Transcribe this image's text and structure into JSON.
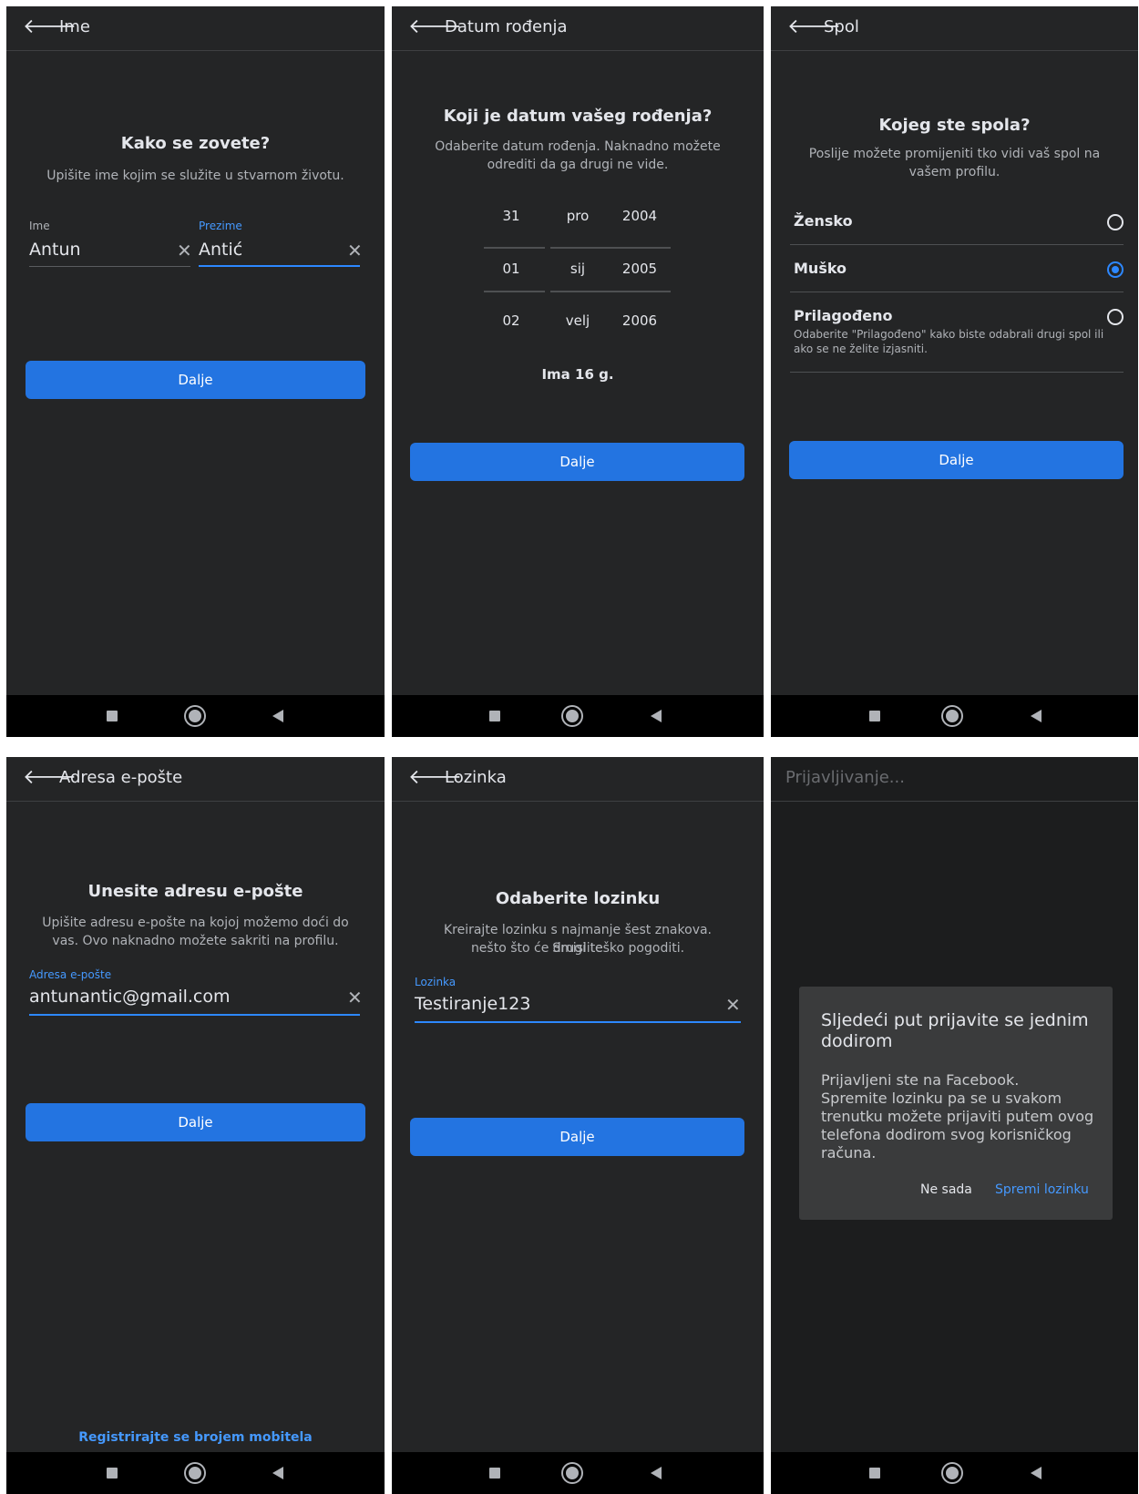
{
  "panels": {
    "name": {
      "title": "Ime",
      "heading": "Kako se zovete?",
      "subtitle": "Upišite ime kojim se služite u stvarnom životu.",
      "first_label": "Ime",
      "first_value": "Antun",
      "last_label": "Prezime",
      "last_value": "Antić",
      "button": "Dalje"
    },
    "birthday": {
      "title": "Datum rođenja",
      "heading": "Koji je datum vašeg rođenja?",
      "subtitle_l1": "Odaberite datum rođenja. Naknadno možete",
      "subtitle_l2": "odrediti da ga drugi ne vide.",
      "days": [
        "31",
        "01",
        "02"
      ],
      "months": [
        "pro",
        "sij",
        "velj"
      ],
      "years": [
        "2004",
        "2005",
        "2006"
      ],
      "age": "Ima 16 g.",
      "button": "Dalje"
    },
    "gender": {
      "title": "Spol",
      "heading": "Kojeg ste spola?",
      "subtitle_l1": "Poslije možete promijeniti tko vidi vaš spol na",
      "subtitle_l2": "vašem profilu.",
      "options": [
        {
          "label": "Žensko",
          "selected": false
        },
        {
          "label": "Muško",
          "selected": true
        },
        {
          "label": "Prilagođeno",
          "selected": false
        }
      ],
      "custom_desc_l1": "Odaberite \"Prilagođeno\" kako biste odabrali drugi spol ili",
      "custom_desc_l2": "ako se ne želite izjasniti.",
      "button": "Dalje"
    },
    "email": {
      "title": "Adresa e-pošte",
      "heading": "Unesite adresu e-pošte",
      "subtitle_l1": "Upišite adresu e-pošte na kojoj možemo doći do",
      "subtitle_l2": "vas. Ovo naknadno možete sakriti na profilu.",
      "field_label": "Adresa e-pošte",
      "field_value": "antunantic@gmail.com",
      "button": "Dalje",
      "footer_link": "Registrirajte se brojem mobitela"
    },
    "password": {
      "title": "Lozinka",
      "heading": "Odaberite lozinku",
      "subtitle_l1": "Kreirajte lozinku s najmanje šest znakova. Smislite",
      "subtitle_l2": "nešto što će drugi teško pogoditi.",
      "field_label": "Lozinka",
      "field_value": "Testiranje123",
      "button": "Dalje"
    },
    "login": {
      "title": "Prijavljivanje...",
      "dialog_title_l1": "Sljedeći put prijavite se jednim",
      "dialog_title_l2": "dodirom",
      "dialog_body_l1": "Prijavljeni ste na Facebook.",
      "dialog_body_l2": "Spremite lozinku pa se u svakom",
      "dialog_body_l3": "trenutku možete prijaviti putem ovog",
      "dialog_body_l4": "telefona dodirom svog korisničkog",
      "dialog_body_l5": "računa.",
      "dismiss": "Ne sada",
      "confirm": "Spremi lozinku"
    }
  },
  "colors": {
    "background": "#242526",
    "accent": "#2374e1",
    "link": "#4599ff",
    "text": "#e4e6eb",
    "muted": "#b0b3b8"
  },
  "icons": {
    "back": "arrow-left-icon",
    "clear": "close-icon",
    "nav_recent": "square-icon",
    "nav_home": "circle-icon",
    "nav_back": "triangle-icon"
  }
}
